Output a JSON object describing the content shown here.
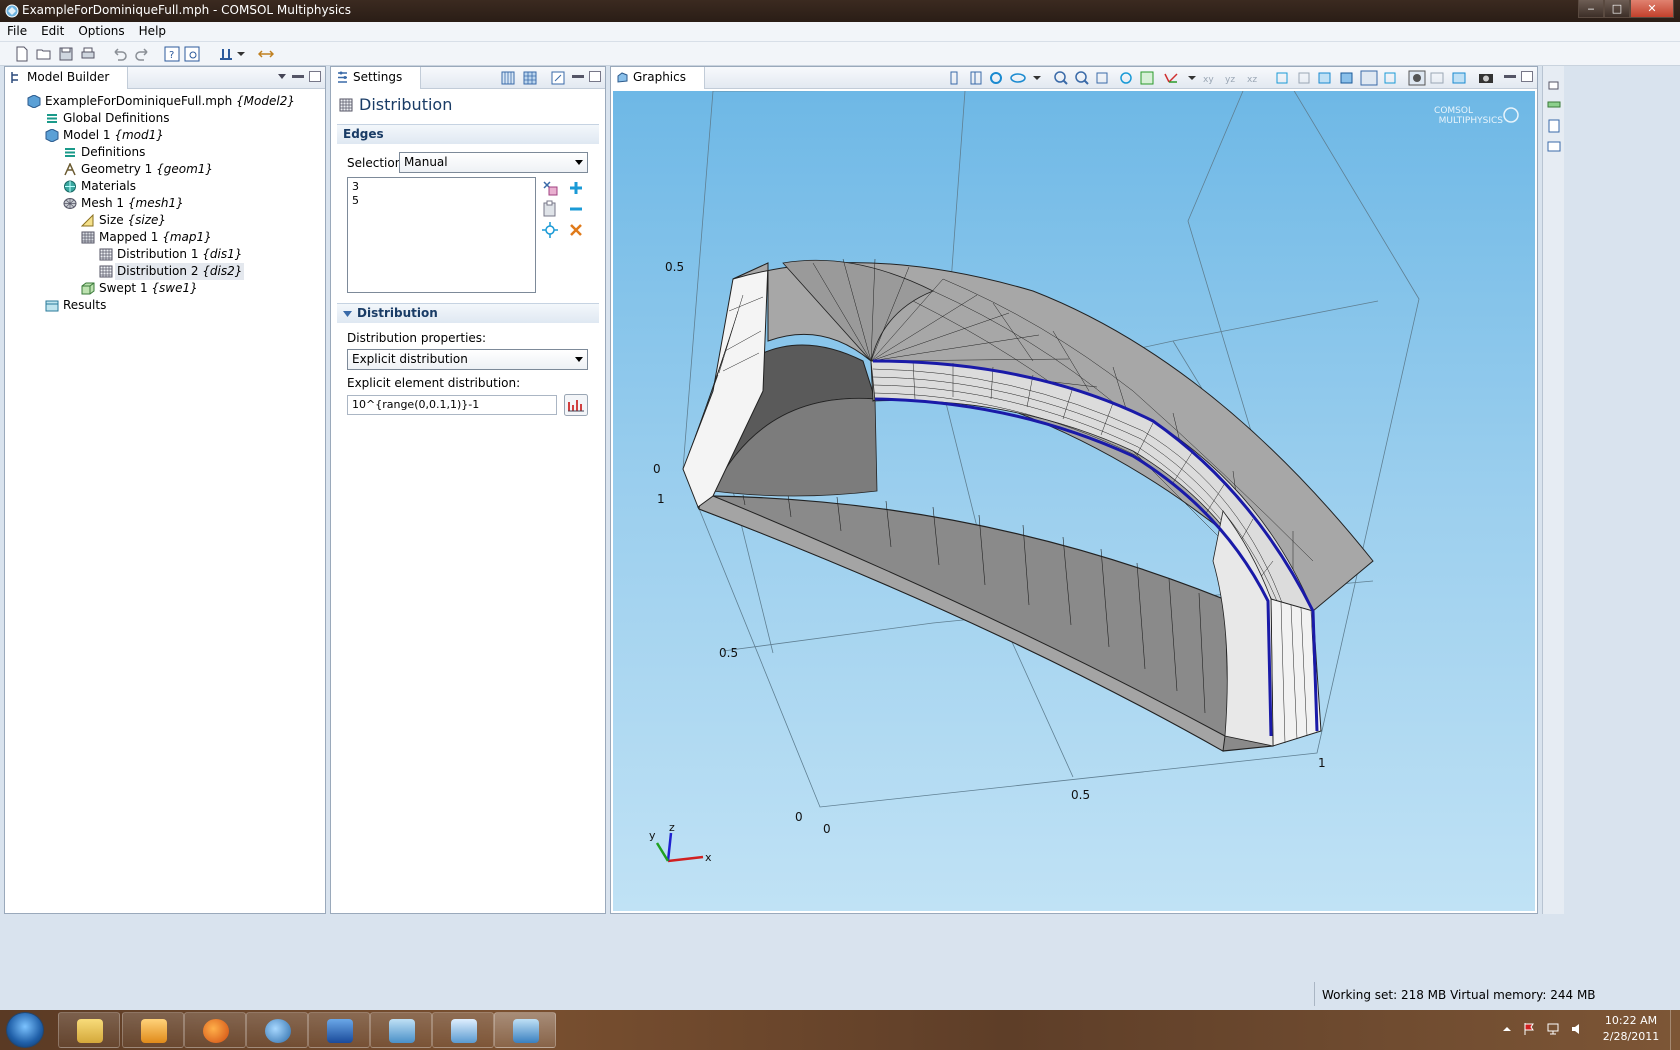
{
  "window": {
    "title": "ExampleForDominiqueFull.mph - COMSOL Multiphysics",
    "min": "‒",
    "max": "□",
    "close": "✕"
  },
  "menu": [
    "File",
    "Edit",
    "Options",
    "Help"
  ],
  "model_builder": {
    "tab_label": "Model Builder",
    "tree": [
      {
        "label": "ExampleForDominiqueFull.mph",
        "tag": "{Model2}",
        "icon": "model-file-icon"
      },
      {
        "label": "Global Definitions",
        "tag": "",
        "icon": "global-definitions-icon"
      },
      {
        "label": "Model 1",
        "tag": "{mod1}",
        "icon": "model-icon"
      },
      {
        "label": "Definitions",
        "tag": "",
        "icon": "definitions-icon"
      },
      {
        "label": "Geometry 1",
        "tag": "{geom1}",
        "icon": "geometry-icon"
      },
      {
        "label": "Materials",
        "tag": "",
        "icon": "materials-icon"
      },
      {
        "label": "Mesh 1",
        "tag": "{mesh1}",
        "icon": "mesh-icon"
      },
      {
        "label": "Size",
        "tag": "{size}",
        "icon": "size-icon"
      },
      {
        "label": "Mapped 1",
        "tag": "{map1}",
        "icon": "mapped-icon"
      },
      {
        "label": "Distribution 1",
        "tag": "{dis1}",
        "icon": "distribution-icon"
      },
      {
        "label": "Distribution 2",
        "tag": "{dis2}",
        "icon": "distribution-icon"
      },
      {
        "label": "Swept 1",
        "tag": "{swe1}",
        "icon": "swept-icon"
      },
      {
        "label": "Results",
        "tag": "",
        "icon": "results-icon"
      }
    ]
  },
  "settings": {
    "tab_label": "Settings",
    "title": "Distribution",
    "edges_section": "Edges",
    "selection_label": "Selection:",
    "selection_value": "Manual",
    "selected_edges": [
      "3",
      "5"
    ],
    "distribution_section": "Distribution",
    "dist_props_label": "Distribution properties:",
    "dist_props_value": "Explicit distribution",
    "explicit_label": "Explicit element distribution:",
    "explicit_value": "10^{range(0,0.1,1)}-1"
  },
  "graphics": {
    "tab_label": "Graphics",
    "logo_line1": "COMSOL",
    "logo_line2": "MULTIPHYSICS",
    "axis_labels": {
      "z_05": "0.5",
      "z_0": "0",
      "y_1": "1",
      "y_05": "0.5",
      "y_0": "0",
      "x_0": "0",
      "x_05": "0.5",
      "x_1": "1"
    },
    "triad": {
      "x": "x",
      "y": "y",
      "z": "z"
    },
    "highlight_color": "#1a1aa8",
    "background_top": "#6eb8e6",
    "background_bottom": "#c0e2f5"
  },
  "status": {
    "memory": "Working set: 218 MB  Virtual memory: 244 MB"
  },
  "taskbar": {
    "time": "10:22 AM",
    "date": "2/28/2011"
  }
}
